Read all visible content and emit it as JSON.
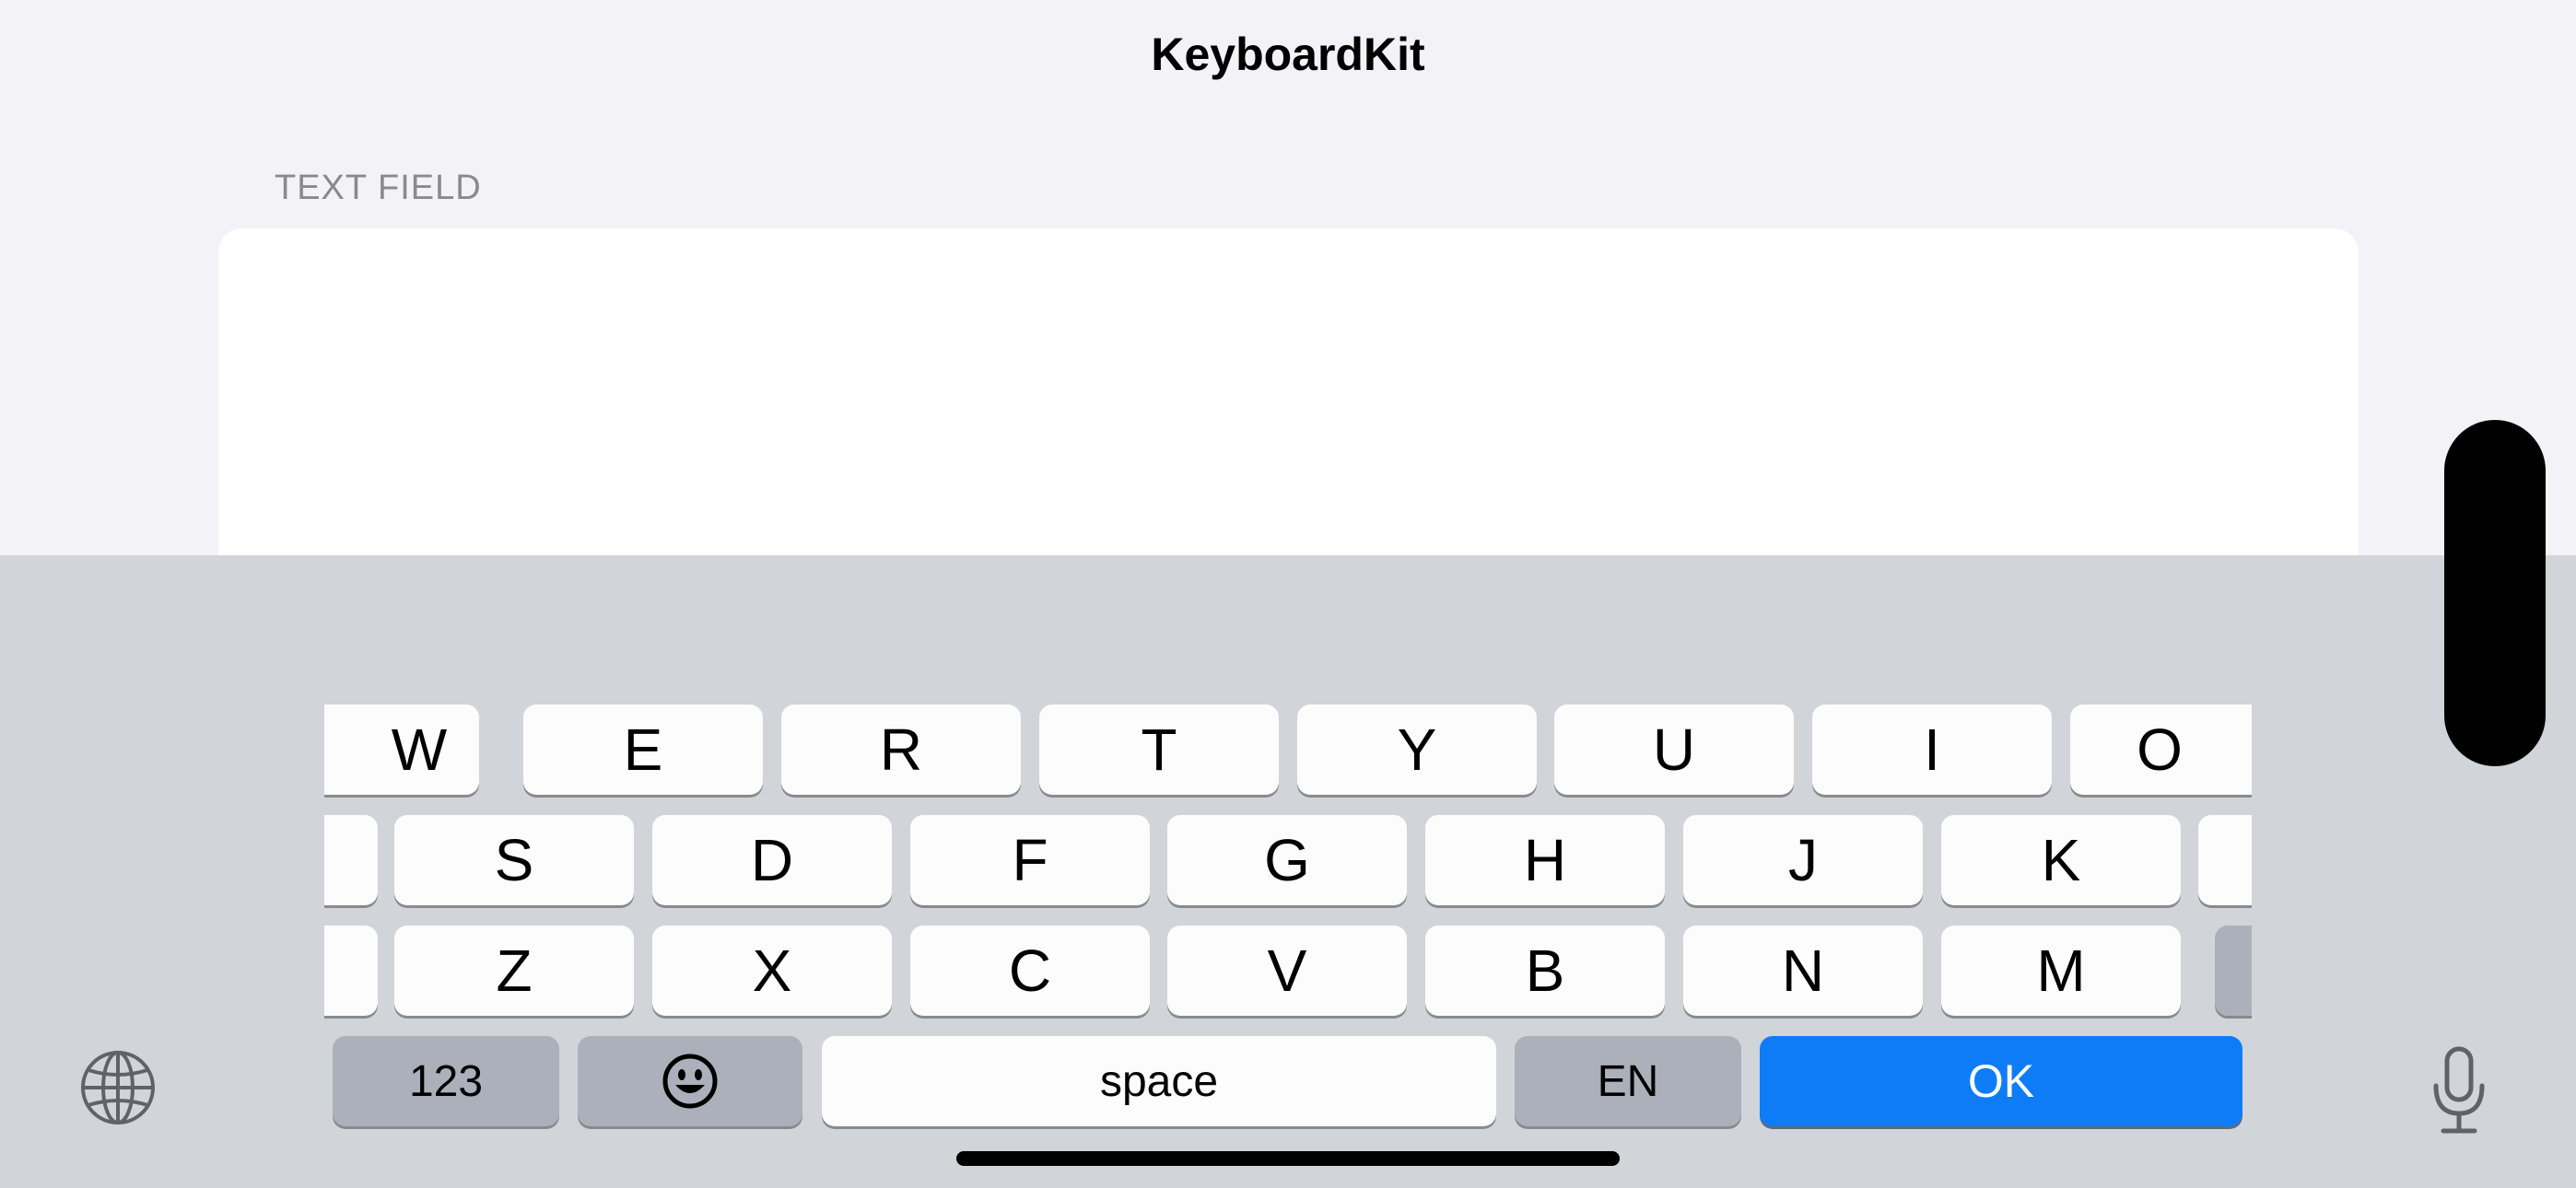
{
  "nav": {
    "title": "KeyboardKit"
  },
  "section": {
    "label": "TEXT FIELD"
  },
  "text_field": {
    "value": ""
  },
  "keyboard": {
    "row1": [
      "W",
      "E",
      "R",
      "T",
      "Y",
      "U",
      "I",
      "O"
    ],
    "row2": [
      "S",
      "D",
      "F",
      "G",
      "H",
      "J",
      "K"
    ],
    "row3": [
      "Z",
      "X",
      "C",
      "V",
      "B",
      "N",
      "M"
    ],
    "numbers_label": "123",
    "space_label": "space",
    "locale_label": "EN",
    "return_label": "OK",
    "icons": {
      "emoji": "emoji-icon",
      "globe": "globe-icon",
      "dictation": "microphone-icon"
    },
    "colors": {
      "background": "#d1d4d9",
      "key": "#fcfcfc",
      "system_key": "#abb0ba",
      "return_key": "#0f7cf7"
    }
  }
}
